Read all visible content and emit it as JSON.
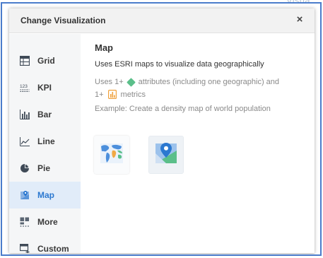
{
  "background_text": "Visua",
  "dialog": {
    "title": "Change Visualization",
    "close_glyph": "×"
  },
  "sidebar": {
    "items": [
      {
        "label": "Grid",
        "icon": "grid-icon",
        "active": false
      },
      {
        "label": "KPI",
        "icon": "kpi-icon",
        "active": false
      },
      {
        "label": "Bar",
        "icon": "bar-chart-icon",
        "active": false
      },
      {
        "label": "Line",
        "icon": "line-chart-icon",
        "active": false
      },
      {
        "label": "Pie",
        "icon": "pie-chart-icon",
        "active": false
      },
      {
        "label": "Map",
        "icon": "map-icon",
        "active": true
      },
      {
        "label": "More",
        "icon": "more-icon",
        "active": false
      },
      {
        "label": "Custom",
        "icon": "custom-icon",
        "active": false
      }
    ],
    "kpi_icon_text": "123"
  },
  "content": {
    "title": "Map",
    "description": "Uses ESRI maps to visualize data geographically",
    "uses_line1_prefix": "Uses 1+",
    "uses_line1_suffix": "attributes (including one geographic) and",
    "uses_line2_prefix": "1+",
    "uses_line2_suffix": "metrics",
    "example": "Example: Create a density map of world population",
    "tiles": [
      {
        "icon": "world-map-icon"
      },
      {
        "icon": "map-pin-icon"
      }
    ]
  },
  "colors": {
    "accent": "#2b78d0",
    "active_bg": "#e1ecf9",
    "attribute_icon": "#5bbf8a",
    "metric_icon": "#f0a13b",
    "frame_border": "#4a7ccb"
  }
}
